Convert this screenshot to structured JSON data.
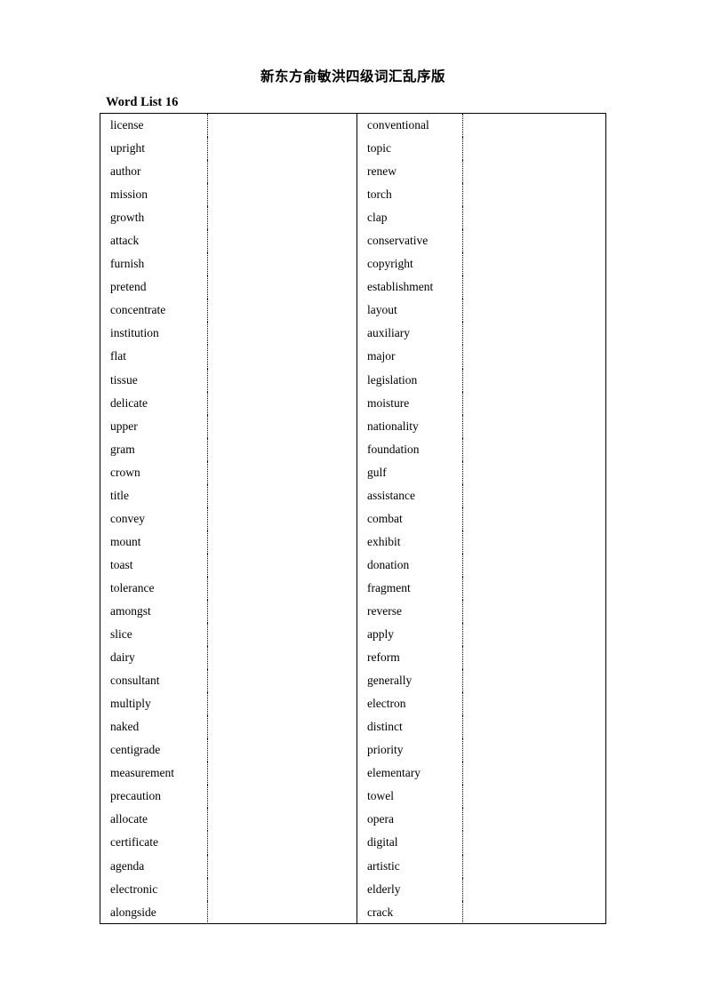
{
  "document": {
    "title": "新东方俞敏洪四级词汇乱序版",
    "list_heading": "Word List 16"
  },
  "table": {
    "columns": [
      {
        "name": "words-left",
        "type": "word"
      },
      {
        "name": "blank-left",
        "type": "blank"
      },
      {
        "name": "words-right",
        "type": "word"
      },
      {
        "name": "blank-right",
        "type": "blank"
      }
    ],
    "row_count": 35,
    "words_left": [
      "license",
      "upright",
      "author",
      "mission",
      "growth",
      "attack",
      "furnish",
      "pretend",
      "concentrate",
      "institution",
      "flat",
      "tissue",
      "delicate",
      "upper",
      "gram",
      "crown",
      "title",
      "convey",
      "mount",
      "toast",
      "tolerance",
      "amongst",
      "slice",
      "dairy",
      "consultant",
      "multiply",
      "naked",
      "centigrade",
      "measurement",
      "precaution",
      "allocate",
      "certificate",
      "agenda",
      "electronic",
      "alongside"
    ],
    "words_right": [
      "conventional",
      "topic",
      "renew",
      "torch",
      "clap",
      "conservative",
      "copyright",
      "establishment",
      "layout",
      "auxiliary",
      "major",
      "legislation",
      "moisture",
      "nationality",
      "foundation",
      "gulf",
      "assistance",
      "combat",
      "exhibit",
      "donation",
      "fragment",
      "reverse",
      "apply",
      "reform",
      "generally",
      "electron",
      "distinct",
      "priority",
      "elementary",
      "towel",
      "opera",
      "digital",
      "artistic",
      "elderly",
      "crack"
    ],
    "blanks_left": [
      "",
      "",
      "",
      "",
      "",
      "",
      "",
      "",
      "",
      "",
      "",
      "",
      "",
      "",
      "",
      "",
      "",
      "",
      "",
      "",
      "",
      "",
      "",
      "",
      "",
      "",
      "",
      "",
      "",
      "",
      "",
      "",
      "",
      "",
      ""
    ],
    "blanks_right": [
      "",
      "",
      "",
      "",
      "",
      "",
      "",
      "",
      "",
      "",
      "",
      "",
      "",
      "",
      "",
      "",
      "",
      "",
      "",
      "",
      "",
      "",
      "",
      "",
      "",
      "",
      "",
      "",
      "",
      "",
      "",
      "",
      "",
      "",
      ""
    ]
  },
  "style": {
    "text_color": "#000000",
    "background": "#ffffff",
    "border_color": "#000000"
  }
}
